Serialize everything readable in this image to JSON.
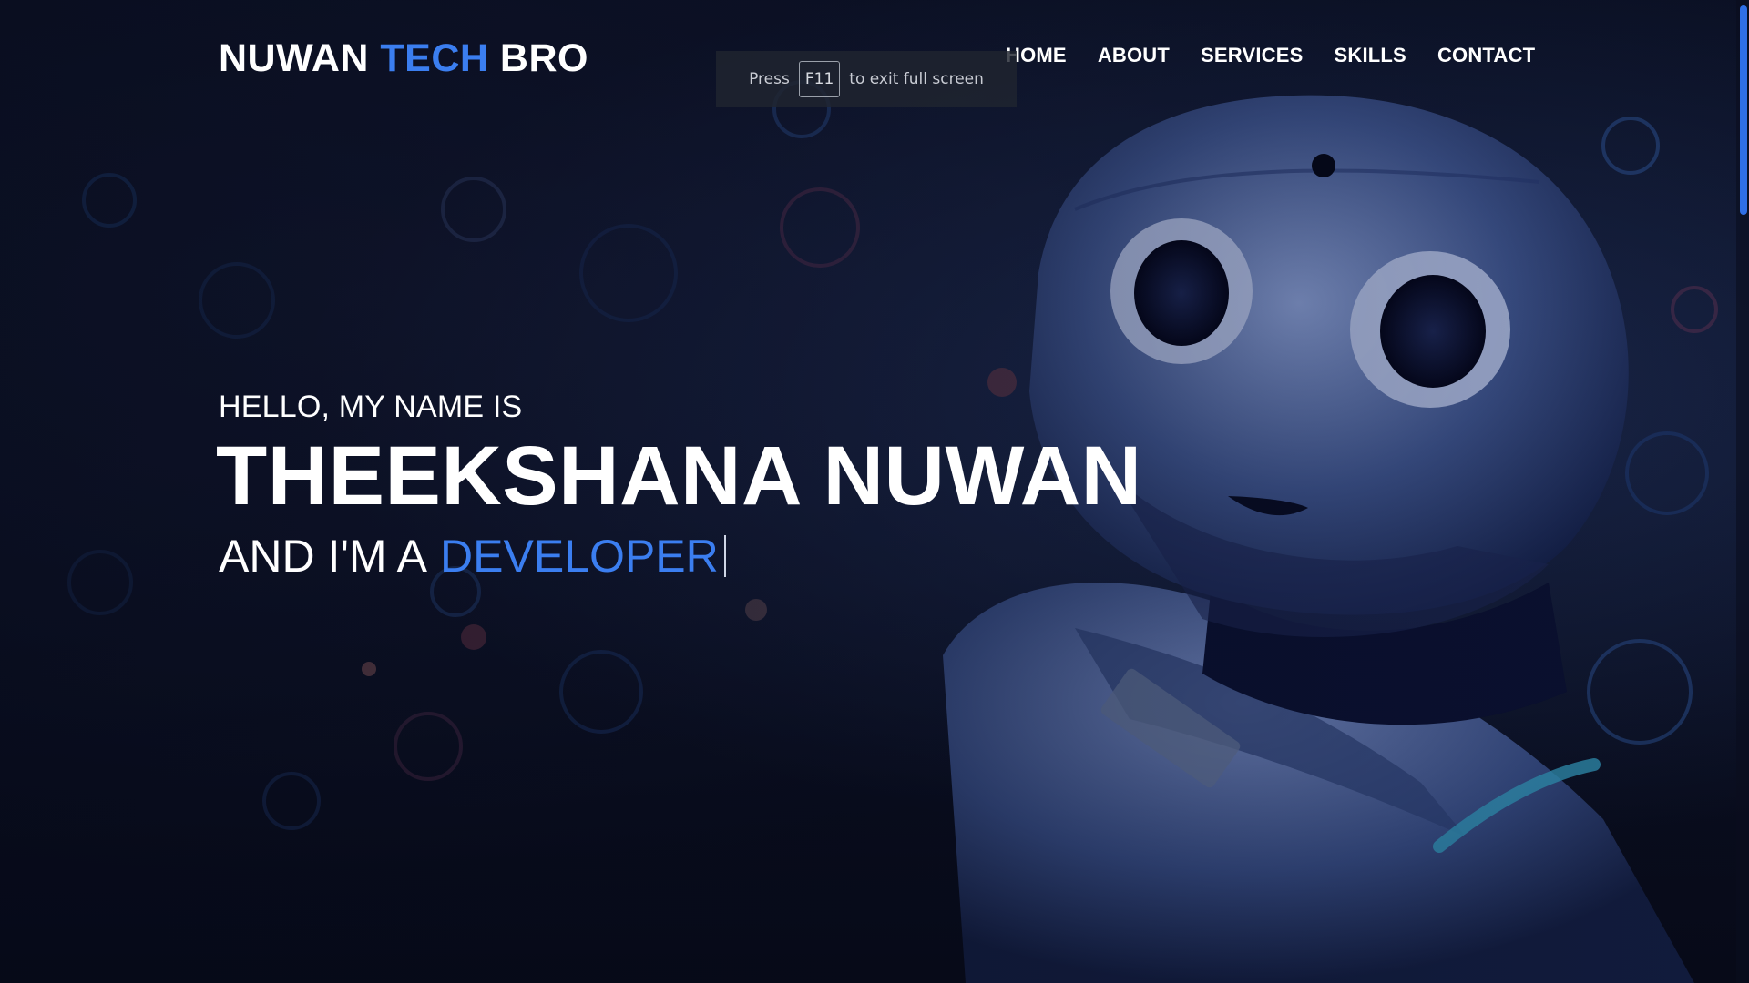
{
  "brand": {
    "part1": "NUWAN",
    "part2": "TECH",
    "part3": "BRO"
  },
  "nav": {
    "items": [
      {
        "label": "HOME"
      },
      {
        "label": "ABOUT"
      },
      {
        "label": "SERVICES"
      },
      {
        "label": "SKILLS"
      },
      {
        "label": "CONTACT"
      }
    ]
  },
  "fullscreen_notice": {
    "prefix": "Press",
    "key": "F11",
    "suffix": "to exit full screen"
  },
  "hero": {
    "greeting": "HELLO, MY NAME IS",
    "name": "THEEKSHANA NUWAN",
    "role_prefix": "AND I'M A",
    "role_typed": "DEVELOPER"
  },
  "colors": {
    "accent": "#3b7ef0",
    "background": "#080c1c",
    "text": "#ffffff"
  }
}
